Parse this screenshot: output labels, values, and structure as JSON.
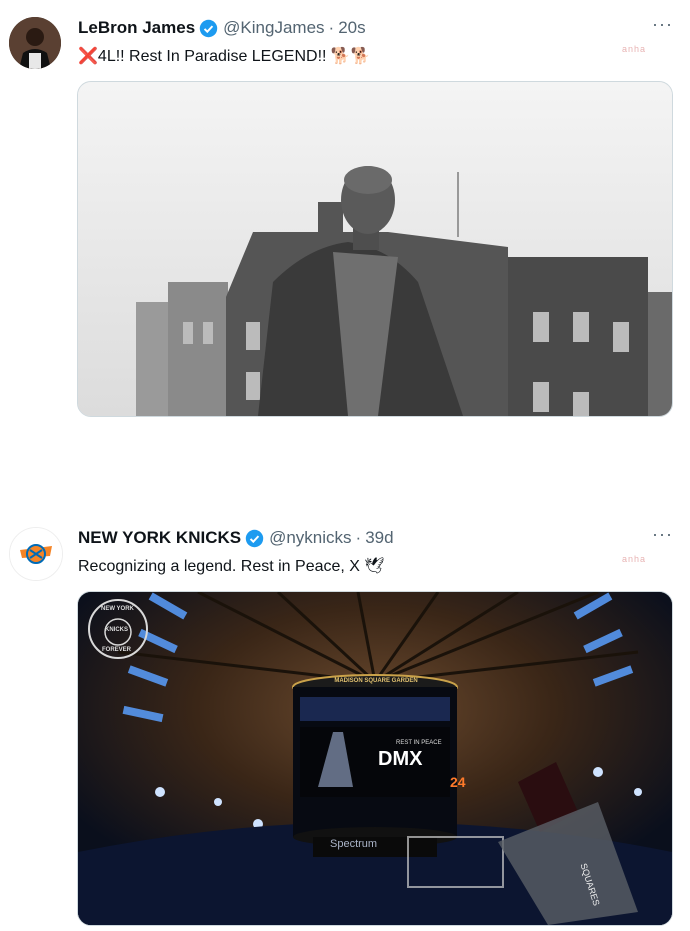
{
  "tweets": [
    {
      "name": "LeBron James",
      "handle": "@KingJames",
      "separator": "·",
      "time": "20s",
      "text_prefix": "❌",
      "text": "4L!! Rest In Paradise LEGEND!! 🐕🐕",
      "more": "···",
      "watermark": "anha",
      "verified_color": "#1d9bf0",
      "avatar_icon": "player-avatar-icon",
      "media_icon": "photo-of-man-in-street-icon"
    },
    {
      "name": "NEW YORK KNICKS",
      "handle": "@nyknicks",
      "separator": "·",
      "time": "39d",
      "text": "Recognizing a legend. Rest in Peace, X 🕊",
      "more": "···",
      "watermark": "anha",
      "verified_color": "#1d9bf0",
      "avatar_icon": "knicks-logo-icon",
      "media": {
        "arena_sign": "MADISON SQUARE GARDEN",
        "board_small": "REST IN PEACE",
        "board_big": "DMX",
        "sponsor": "Spectrum",
        "side_banner": "SQUARES",
        "badge_line1": "NEW YORK",
        "badge_mid": "KNICKS",
        "badge_line2": "FOREVER",
        "shot_clock": "24"
      }
    }
  ]
}
